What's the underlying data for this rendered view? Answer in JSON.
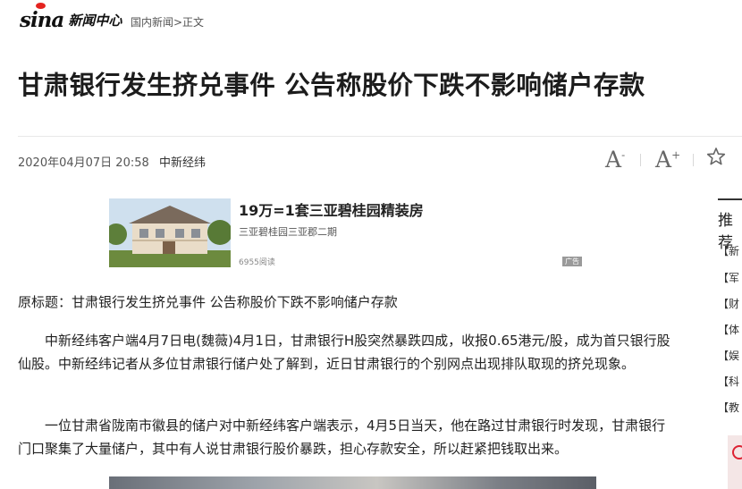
{
  "header": {
    "logo_text": "sina",
    "channel": "新闻中心",
    "breadcrumb": "国内新闻>正文"
  },
  "article": {
    "title": "甘肃银行发生挤兑事件 公告称股价下跌不影响储户存款",
    "date": "2020年04月07日 20:58",
    "source": "中新经纬",
    "paragraphs": [
      "原标题：甘肃银行发生挤兑事件 公告称股价下跌不影响储户存款",
      "中新经纬客户端4月7日电(魏薇)4月1日，甘肃银行H股突然暴跌四成，收报0.65港元/股，成为首只银行股仙股。中新经纬记者从多位甘肃银行储户处了解到，近日甘肃银行的个别网点出现排队取现的挤兑现象。",
      "一位甘肃省陇南市徽县的储户对中新经纬客户端表示，4月5日当天，他在路过甘肃银行时发现，甘肃银行门口聚集了大量储户，其中有人说甘肃银行股价暴跌，担心存款安全，所以赶紧把钱取出来。"
    ]
  },
  "toolbar": {
    "font_smaller": "A",
    "font_smaller_mark": "-",
    "font_larger": "A",
    "font_larger_mark": "+",
    "favorite_icon": "star-icon"
  },
  "ad": {
    "title": "19万=1套三亚碧桂园精装房",
    "subtitle": "三亚碧桂园三亚郡二期",
    "reads": "6955阅读",
    "tag": "广告"
  },
  "sidebar": {
    "heading": "推荐",
    "items": [
      "【新",
      "【军",
      "【财",
      "【体",
      "【娱",
      "【科",
      "【教"
    ]
  },
  "colors": {
    "brand_red": "#e4231f",
    "text_dark": "#1c1c1c"
  }
}
